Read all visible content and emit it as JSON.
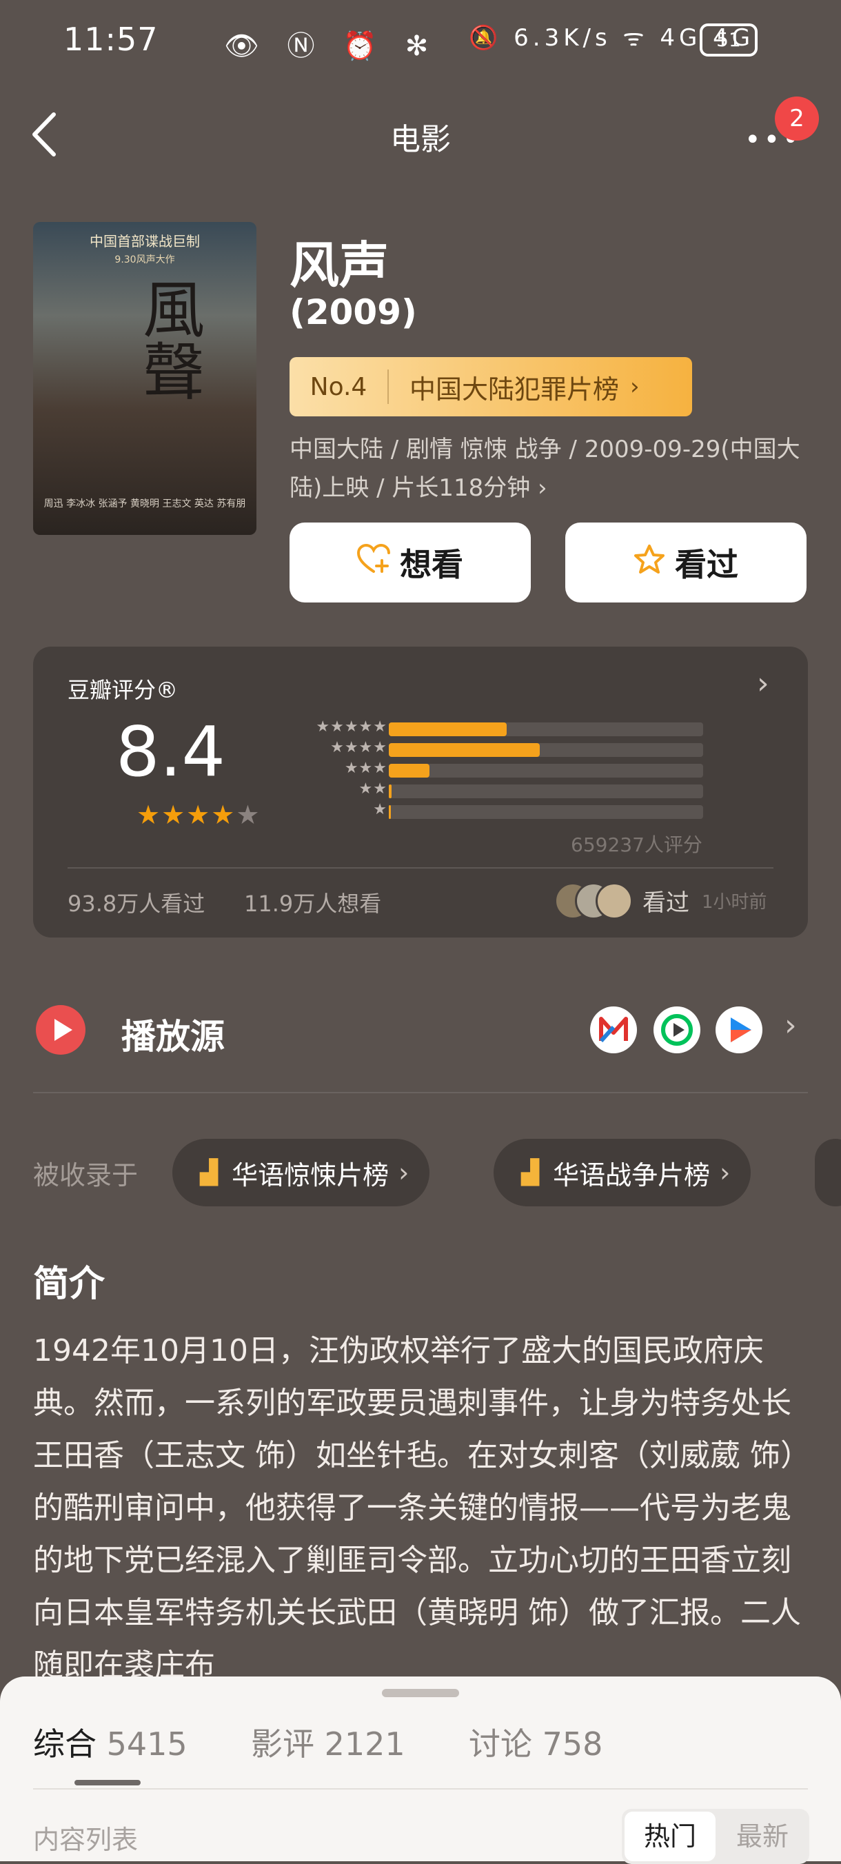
{
  "status_bar": {
    "time": "11:57",
    "left_icons": "👁 Ⓝ ⏰ ✻",
    "right_icons": "🔕 6.3K/s ᯤ 4G 4G",
    "battery": "51"
  },
  "nav": {
    "title": "电影",
    "more_icon": "•••",
    "badge": "2"
  },
  "poster": {
    "tagline": "中国首部谍战巨制",
    "subtag": "9.30风声大作",
    "calligraphy": "風聲",
    "credits": "周迅 李冰冰 张涵予 黄晓明 王志文 英达 苏有朋"
  },
  "movie": {
    "title": "风声",
    "year": "(2009)",
    "rank_no": "No.4",
    "rank_name": "中国大陆犯罪片榜",
    "meta": "中国大陆 / 剧情 惊悚 战争 / 2009-09-29(中国大陆)上映 / 片长118分钟 ›"
  },
  "actions": {
    "want": "想看",
    "seen": "看过"
  },
  "rating": {
    "label": "豆瓣评分®",
    "score": "8.4",
    "stars_full": 4,
    "distribution": [
      {
        "stars": "★★★★★",
        "fraction": 0.375
      },
      {
        "stars": "★★★★",
        "fraction": 0.48
      },
      {
        "stars": "★★★",
        "fraction": 0.13
      },
      {
        "stars": "★★",
        "fraction": 0.008
      },
      {
        "stars": "★",
        "fraction": 0.004
      }
    ],
    "count": "659237人评分",
    "seen_count": "93.8万人看过",
    "want_count": "11.9万人想看",
    "friend_status": "看过",
    "friend_time": "1小时前"
  },
  "play": {
    "label": "播放源",
    "sources": [
      "MGTV",
      "iQIYI",
      "Youku"
    ]
  },
  "collections": {
    "label": "被收录于",
    "items": [
      "华语惊悚片榜",
      "华语战争片榜"
    ]
  },
  "intro": {
    "heading": "简介",
    "text": "1942年10月10日，汪伪政权举行了盛大的国民政府庆典。然而，一系列的军政要员遇刺事件，让身为特务处长王田香（王志文 饰）如坐针毡。在对女刺客（刘威葳 饰）的酷刑审问中，他获得了一条关键的情报——代号为老鬼的地下党已经混入了剿匪司令部。立功心切的王田香立刻向日本皇军特务机关长武田（黄晓明 饰）做了汇报。二人随即在裘庄布"
  },
  "sheet": {
    "tabs": [
      {
        "label": "综合",
        "count": "5415"
      },
      {
        "label": "影评",
        "count": "2121"
      },
      {
        "label": "讨论",
        "count": "758"
      }
    ],
    "list_label": "内容列表",
    "sort_hot": "热门",
    "sort_new": "最新"
  },
  "colors": {
    "background": "#5a524e",
    "accent_orange": "#f5a21c",
    "badge_red": "#f04747"
  }
}
